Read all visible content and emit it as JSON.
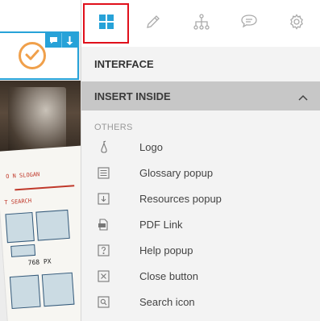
{
  "tabs": [
    {
      "name": "grid-icon",
      "active": true
    },
    {
      "name": "pencil-icon",
      "active": false
    },
    {
      "name": "hierarchy-icon",
      "active": false
    },
    {
      "name": "comment-icon",
      "active": false
    },
    {
      "name": "gear-icon",
      "active": false
    }
  ],
  "panel": {
    "interface_label": "INTERFACE",
    "insert_inside_label": "INSERT INSIDE",
    "group_label": "OTHERS",
    "items": [
      {
        "label": "Logo",
        "icon": "pear-icon"
      },
      {
        "label": "Glossary popup",
        "icon": "list-icon"
      },
      {
        "label": "Resources popup",
        "icon": "download-box-icon"
      },
      {
        "label": "PDF Link",
        "icon": "pdf-icon"
      },
      {
        "label": "Help popup",
        "icon": "question-box-icon"
      },
      {
        "label": "Close button",
        "icon": "close-box-icon"
      },
      {
        "label": "Search icon",
        "icon": "search-box-icon"
      }
    ]
  },
  "canvas": {
    "sketch_text_1": "O N SLOGAN",
    "sketch_text_2": "T SEARCH",
    "sketch_dimension": "768 PX",
    "selected_toolbar": [
      "comment-icon",
      "arrow-down-icon"
    ]
  },
  "colors": {
    "accent": "#27a2d8",
    "active_tab_border": "#e0101b",
    "check_color": "#f0a04b"
  }
}
